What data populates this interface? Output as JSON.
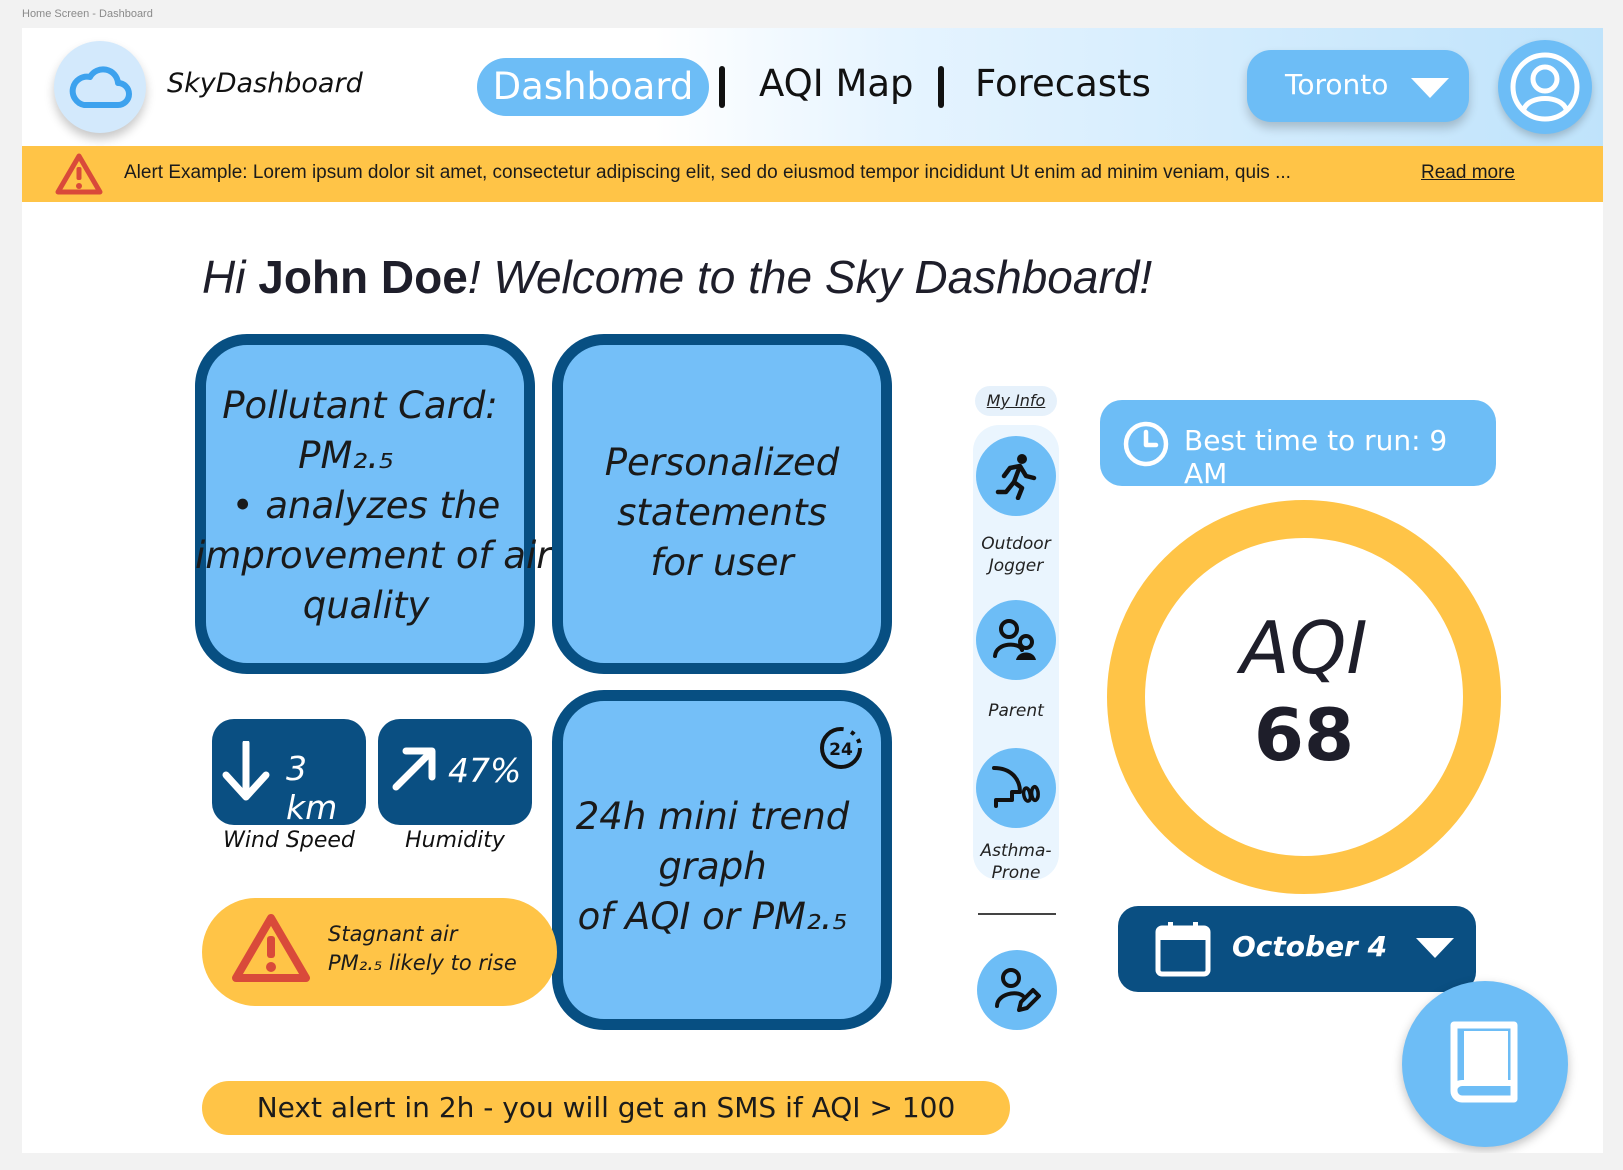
{
  "frame_label": "Home Screen - Dashboard",
  "header": {
    "brand": "SkyDashboard",
    "logo_icon": "cloud-icon",
    "nav": [
      "Dashboard",
      "AQI Map",
      "Forecasts"
    ],
    "active_nav": "Dashboard",
    "city": "Toronto",
    "profile_icon": "user-circle-icon"
  },
  "alert": {
    "text": "Alert Example: Lorem ipsum dolor sit amet, consectetur adipiscing elit, sed do eiusmod tempor incididunt Ut enim ad minim veniam, quis ...",
    "link": "Read more",
    "icon": "warning-icon"
  },
  "greeting": {
    "hi": "Hi ",
    "name": "John Doe",
    "rest": "! Welcome to the Sky Dashboard!"
  },
  "cards": {
    "pollutant": {
      "line1": "Pollutant Card:",
      "line2": "PM₂.₅",
      "line3": "• analyzes the",
      "line4": "improvement of air",
      "line5": "quality"
    },
    "personalized": [
      "Personalized",
      "statements",
      "for user"
    ],
    "trend": {
      "badge": "24",
      "lines": [
        "24h mini trend",
        "graph",
        "of AQI or PM₂.₅"
      ]
    }
  },
  "metrics": {
    "wind": {
      "value": "3 km",
      "label": "Wind Speed",
      "icon": "arrow-down-icon"
    },
    "humidity": {
      "value": "47%",
      "label": "Humidity",
      "icon": "arrow-up-right-icon"
    }
  },
  "warning": {
    "line1": "Stagnant air",
    "line2": "PM₂.₅ likely to rise",
    "icon": "warning-icon"
  },
  "next_alert": "Next alert in 2h - you will get an SMS if AQI > 100",
  "my_info": {
    "title": "My Info",
    "personas": [
      {
        "label1": "Outdoor",
        "label2": "Jogger",
        "icon": "runner-icon"
      },
      {
        "label1": "Parent",
        "label2": "",
        "icon": "parent-icon"
      },
      {
        "label1": "Asthma-",
        "label2": "Prone",
        "icon": "breathing-icon"
      }
    ],
    "edit_icon": "user-edit-icon"
  },
  "best_time": "Best time to run: 9 AM",
  "aqi": {
    "label": "AQI",
    "value": "68"
  },
  "date": "October 4",
  "fab_icon": "book-icon",
  "colors": {
    "primary_light": "#6dbdf6",
    "card_fill": "#74bff8",
    "navy": "#0a4f82",
    "amber": "#ffc447",
    "alert_red": "#d94a3a"
  }
}
